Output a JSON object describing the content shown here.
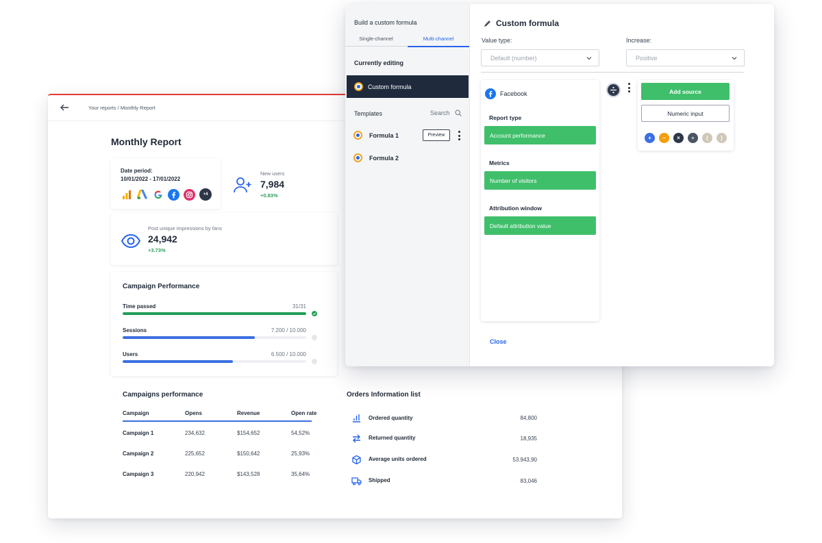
{
  "report": {
    "breadcrumb": "Your reports / Monthly Report",
    "title": "Monthly Report",
    "date_label": "Date period:",
    "date_value": "10/01/2022 - 17/01/2022",
    "more_sources": "+4",
    "new_users": {
      "label": "New users",
      "value": "7,984",
      "delta": "+0.83%"
    },
    "impressions": {
      "label": "Post unique impressions by fans",
      "value": "24,942",
      "delta": "+3.73%"
    },
    "campaign_performance": {
      "title": "Campaign Performance",
      "bars": [
        {
          "label": "Time passed",
          "value": "31/31",
          "progress": 1.0,
          "color": "#1f9d57"
        },
        {
          "label": "Sessions",
          "value": "7.200 / 10.000",
          "progress": 0.72,
          "color": "#3b6fe0"
        },
        {
          "label": "Users",
          "value": "6.500 / 10.000",
          "progress": 0.6,
          "color": "#3b6fe0"
        }
      ]
    },
    "campaigns_table": {
      "title": "Campaigns performance",
      "headers": [
        "Campaign",
        "Opens",
        "Revenue",
        "Open rate"
      ],
      "rows": [
        [
          "Campaign 1",
          "234,632",
          "$154,652",
          "54,52%"
        ],
        [
          "Campaign 2",
          "225,652",
          "$150,642",
          "25,93%"
        ],
        [
          "Campaign 3",
          "220,942",
          "$143,528",
          "35,64%"
        ]
      ]
    },
    "orders": {
      "title": "Orders Information list",
      "items": [
        {
          "icon": "bar-chart-icon",
          "label": "Ordered quantity",
          "value": "84,800"
        },
        {
          "icon": "swap-arrows-icon",
          "label": "Returned quantity",
          "value": "18,935"
        },
        {
          "icon": "box-icon",
          "label": "Average units ordered",
          "value": "53.943,90"
        },
        {
          "icon": "truck-icon",
          "label": "Shipped",
          "value": "83,046"
        }
      ]
    }
  },
  "modal": {
    "left": {
      "title": "Build a custom formula",
      "tabs": [
        "Single-channel",
        "Multi-channel"
      ],
      "active_tab": "Multi-channel",
      "currently_editing": "Currently editing",
      "editing_item": "Custom formula",
      "templates": "Templates",
      "search": "Search",
      "template_items": [
        "Formula 1",
        "Formula 2"
      ],
      "preview": "Preview"
    },
    "right": {
      "title": "Custom formula",
      "value_type": {
        "label": "Value type:",
        "value": "Default (number)"
      },
      "increase": {
        "label": "Increase:",
        "value": "Positive"
      },
      "source": {
        "name": "Facebook",
        "report_type": {
          "label": "Report type",
          "value": "Account performance"
        },
        "metrics": {
          "label": "Metrics",
          "value": "Number of visitors"
        },
        "attribution": {
          "label": "Attribution window",
          "value": "Default attribution value"
        }
      },
      "add_source": "Add source",
      "numeric_input": "Numeric input",
      "operators": [
        {
          "symbol": "+",
          "color": "#3b6fe0"
        },
        {
          "symbol": "−",
          "color": "#f59e0b"
        },
        {
          "symbol": "×",
          "color": "#2d3748"
        },
        {
          "symbol": "÷",
          "color": "#4b5563"
        },
        {
          "symbol": "(",
          "color": "#cfc8b8"
        },
        {
          "symbol": ")",
          "color": "#cfc8b8"
        }
      ],
      "close": "Close"
    }
  },
  "colors": {
    "accent": "#2563eb",
    "green": "#3fbf6a",
    "dark": "#1f2a3d",
    "report_top": "#e53935"
  }
}
